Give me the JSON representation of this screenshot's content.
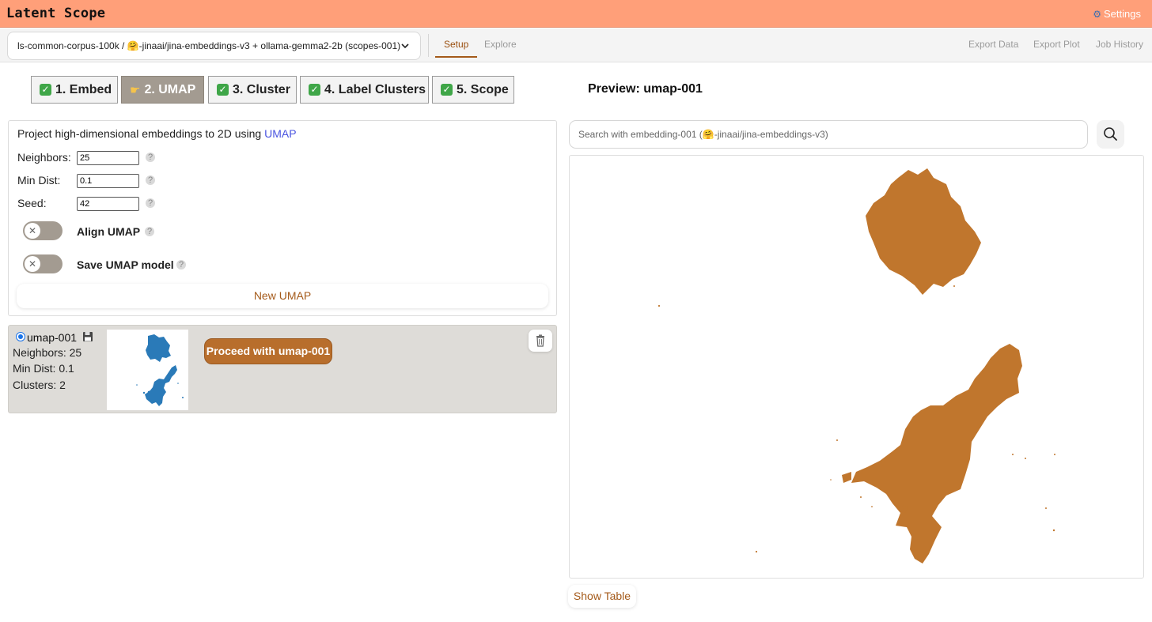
{
  "app": {
    "title": "Latent Scope",
    "settings_label": "Settings"
  },
  "subbar": {
    "dataset_selected": "ls-common-corpus-100k / 🤗-jinaai/jina-embeddings-v3 + ollama-gemma2-2b (scopes-001)",
    "tabs": [
      {
        "label": "Setup",
        "active": true
      },
      {
        "label": "Explore",
        "active": false
      }
    ],
    "links": [
      "Export Data",
      "Export Plot",
      "Job History"
    ]
  },
  "steps": [
    {
      "label": "1. Embed",
      "done": true
    },
    {
      "label": "2. UMAP",
      "active": true
    },
    {
      "label": "3. Cluster",
      "done": true
    },
    {
      "label": "4. Label Clusters",
      "done": true
    },
    {
      "label": "5. Scope",
      "done": true
    }
  ],
  "preview": {
    "title": "Preview: umap-001"
  },
  "umap_form": {
    "description": "Project high-dimensional embeddings to 2D using",
    "description_link": "UMAP",
    "fields": [
      {
        "label": "Neighbors:",
        "value": "25"
      },
      {
        "label": "Min Dist:",
        "value": "0.1"
      },
      {
        "label": "Seed:",
        "value": "42"
      }
    ],
    "toggles": [
      {
        "label": "Align UMAP",
        "on": false
      },
      {
        "label": "Save UMAP model",
        "on": false
      }
    ],
    "submit_label": "New UMAP"
  },
  "umap_result": {
    "name": "umap-001",
    "lines": [
      "Neighbors: 25",
      "Min Dist: 0.1",
      "Clusters: 2"
    ],
    "proceed_label": "Proceed with umap-001"
  },
  "search": {
    "placeholder": "Search with embedding-001 (🤗-jinaai/jina-embeddings-v3)"
  },
  "show_table_label": "Show Table",
  "colors": {
    "header_bg": "#ff9f79",
    "accent": "#a45a1a",
    "point_color": "#c0762d",
    "thumb_point_color": "#2a7ab8",
    "active_step_bg": "#a39b91",
    "check_green": "#3fa648"
  },
  "icons": [
    "gear-icon",
    "chevron-down-icon",
    "check-icon",
    "pointing-hand-icon",
    "help-icon",
    "close-icon",
    "floppy-disk-icon",
    "trash-icon",
    "search-icon"
  ]
}
